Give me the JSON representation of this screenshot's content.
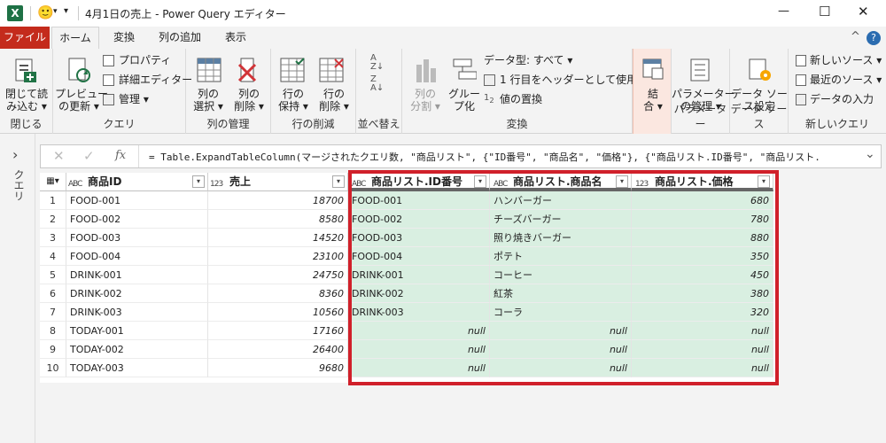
{
  "window": {
    "title": "4月1日の売上 - Power Query エディター",
    "minimize": "—",
    "maximize": "☐",
    "close": "✕",
    "excel_glyph": "X",
    "smiley": "🙂",
    "qat_arrow": "▾",
    "qat_more": "▾"
  },
  "tabs": [
    {
      "label": "ファイル"
    },
    {
      "label": "ホーム"
    },
    {
      "label": "変換"
    },
    {
      "label": "列の追加"
    },
    {
      "label": "表示"
    }
  ],
  "ribbon_controls": {
    "collapse": "^",
    "help": "?"
  },
  "ribbon": {
    "close_group": {
      "label": "閉じる",
      "btn": "閉じて読\nみ込む ▾"
    },
    "query_group": {
      "label": "クエリ",
      "preview": "プレビュー\nの更新 ▾",
      "properties": "プロパティ",
      "advanced": "詳細エディター",
      "manage": "管理 ▾"
    },
    "cols_group": {
      "label": "列の管理",
      "select": "列の\n選択 ▾",
      "remove": "列の\n削除 ▾"
    },
    "rows_group": {
      "label": "行の削減",
      "keep": "行の\n保持 ▾",
      "remove": "行の\n削除 ▾"
    },
    "sort_group": {
      "label": "並べ替え"
    },
    "transform_group": {
      "label": "変換",
      "split": "列の\n分割 ▾",
      "group": "グルー\nプ化",
      "dtype": "データ型: すべて ▾",
      "header": "1 行目をヘッダーとして使用 ▾",
      "replace": "値の置換"
    },
    "combine_group": {
      "label": "",
      "btn": "結\n合 ▾"
    },
    "param_group": {
      "label": "パラメーター",
      "btn": "パラメーター\nの管理 ▾"
    },
    "ds_group": {
      "label": "データ ソース",
      "btn": "データ ソー\nス設定"
    },
    "newq_group": {
      "label": "新しいクエリ",
      "new_source": "新しいソース ▾",
      "recent": "最近のソース ▾",
      "enter": "データの入力"
    }
  },
  "sidebar": {
    "label": "クエリ",
    "arrow": "›"
  },
  "formula": {
    "cancel": "✕",
    "ok": "✓",
    "fx": "fx",
    "text": "= Table.ExpandTableColumn(マージされたクエリ数, \"商品リスト\", {\"ID番号\", \"商品名\", \"価格\"}, {\"商品リスト.ID番号\", \"商品リスト.",
    "expand": "⌄"
  },
  "table": {
    "corner_icon": "▦▾",
    "columns": [
      {
        "type": "ABC",
        "name": "商品ID"
      },
      {
        "type": "123",
        "name": "売上"
      },
      {
        "type": "ABC",
        "name": "商品リスト.ID番号"
      },
      {
        "type": "ABC",
        "name": "商品リスト.商品名"
      },
      {
        "type": "123",
        "name": "商品リスト.価格"
      }
    ],
    "dropdown": "▾",
    "rows": [
      {
        "n": "1",
        "id": "FOOD-001",
        "sales": "18700",
        "lid": "FOOD-001",
        "lname": "ハンバーガー",
        "price": "680"
      },
      {
        "n": "2",
        "id": "FOOD-002",
        "sales": "8580",
        "lid": "FOOD-002",
        "lname": "チーズバーガー",
        "price": "780"
      },
      {
        "n": "3",
        "id": "FOOD-003",
        "sales": "14520",
        "lid": "FOOD-003",
        "lname": "照り焼きバーガー",
        "price": "880"
      },
      {
        "n": "4",
        "id": "FOOD-004",
        "sales": "23100",
        "lid": "FOOD-004",
        "lname": "ポテト",
        "price": "350"
      },
      {
        "n": "5",
        "id": "DRINK-001",
        "sales": "24750",
        "lid": "DRINK-001",
        "lname": "コーヒー",
        "price": "450"
      },
      {
        "n": "6",
        "id": "DRINK-002",
        "sales": "8360",
        "lid": "DRINK-002",
        "lname": "紅茶",
        "price": "380"
      },
      {
        "n": "7",
        "id": "DRINK-003",
        "sales": "10560",
        "lid": "DRINK-003",
        "lname": "コーラ",
        "price": "320"
      },
      {
        "n": "8",
        "id": "TODAY-001",
        "sales": "17160",
        "lid": "null",
        "lname": "null",
        "price": "null"
      },
      {
        "n": "9",
        "id": "TODAY-002",
        "sales": "26400",
        "lid": "null",
        "lname": "null",
        "price": "null"
      },
      {
        "n": "10",
        "id": "TODAY-003",
        "sales": "9680",
        "lid": "null",
        "lname": "null",
        "price": "null"
      }
    ]
  },
  "colors": {
    "accent": "#217346",
    "file_tab": "#c42b1c",
    "highlight": "#d0202a",
    "new_col_bg": "#d9efe1"
  }
}
